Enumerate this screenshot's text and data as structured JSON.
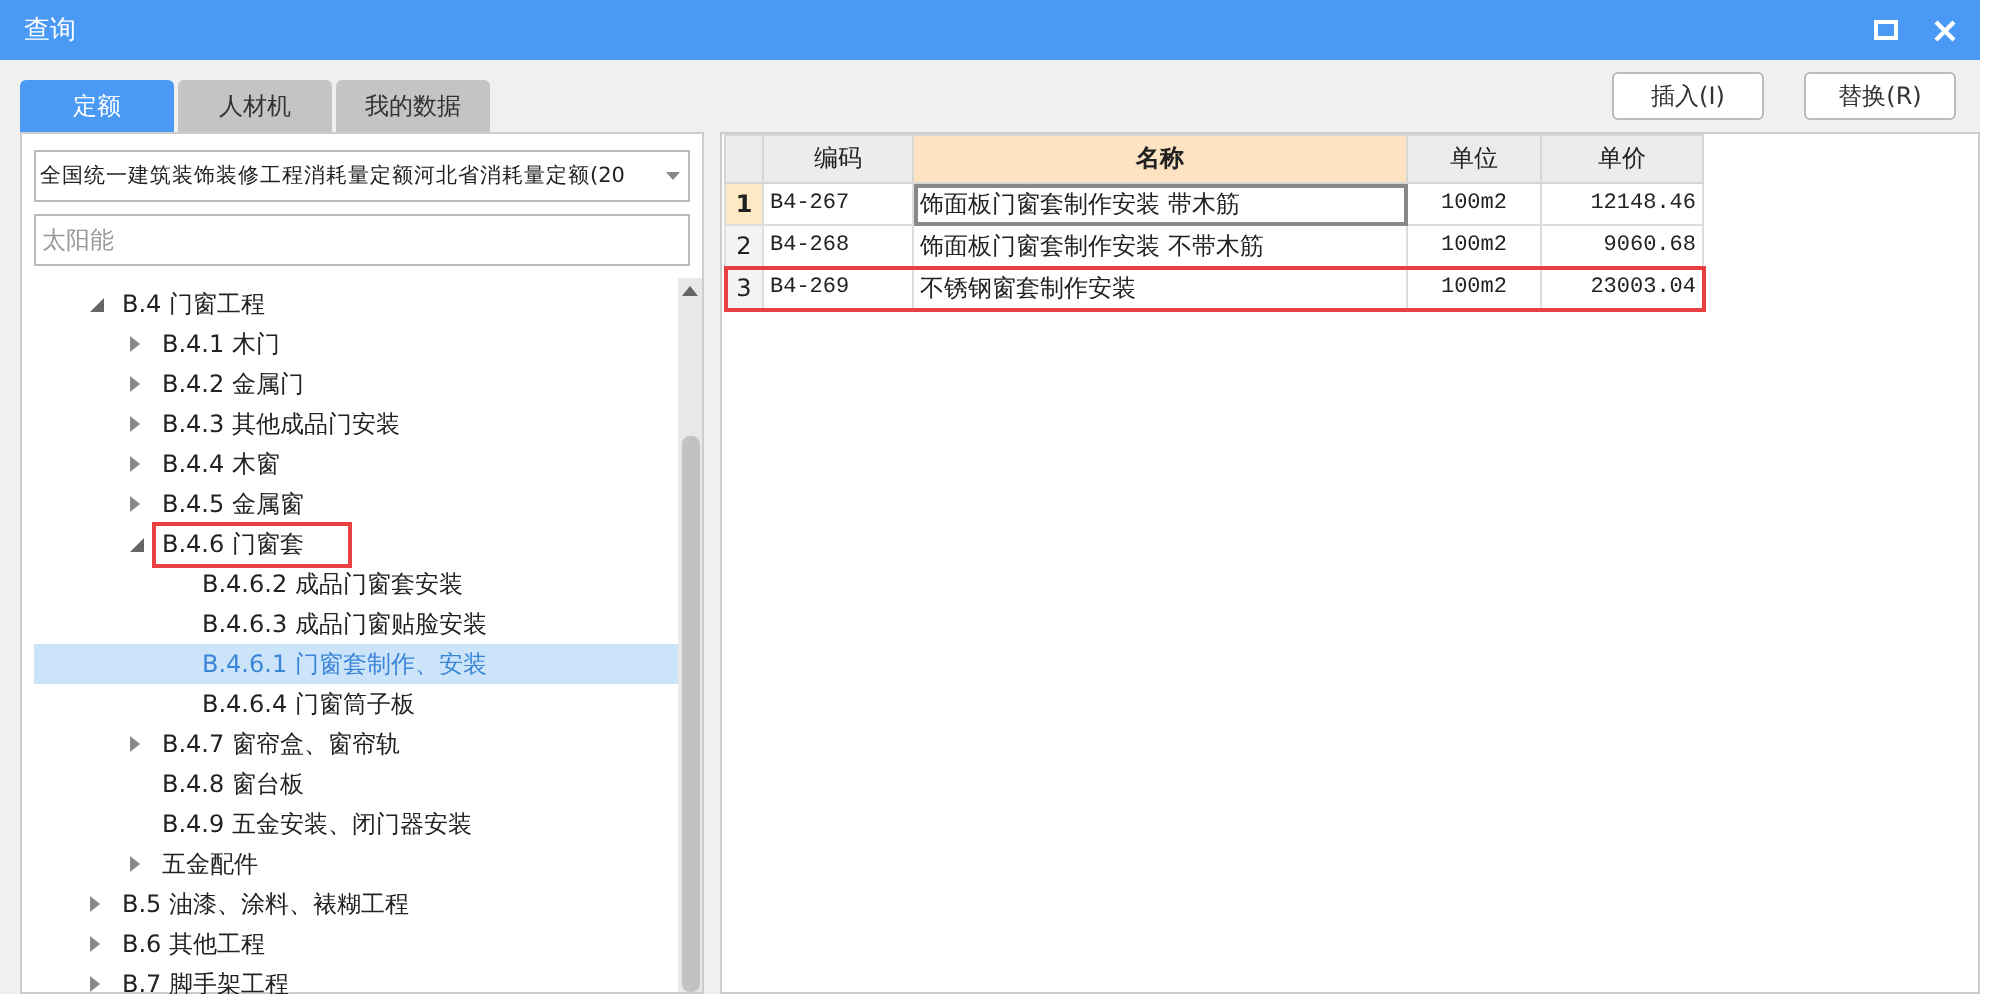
{
  "window": {
    "title": "查询"
  },
  "tabs": [
    {
      "label": "定额",
      "selected": true
    },
    {
      "label": "人材机",
      "selected": false
    },
    {
      "label": "我的数据",
      "selected": false
    }
  ],
  "library": {
    "value": "全国统一建筑装饰装修工程消耗量定额河北省消耗量定额(20"
  },
  "search": {
    "value": "太阳能"
  },
  "tree": [
    {
      "label": "B.4 门窗工程",
      "expanded": true,
      "selected": false,
      "highlighted": false,
      "children": [
        {
          "label": "B.4.1 木门",
          "expanded": false,
          "selected": false,
          "highlighted": false
        },
        {
          "label": "B.4.2 金属门",
          "expanded": false,
          "selected": false,
          "highlighted": false
        },
        {
          "label": "B.4.3 其他成品门安装",
          "expanded": false,
          "selected": false,
          "highlighted": false
        },
        {
          "label": "B.4.4 木窗",
          "expanded": false,
          "selected": false,
          "highlighted": false
        },
        {
          "label": "B.4.5 金属窗",
          "expanded": false,
          "selected": false,
          "highlighted": false
        },
        {
          "label": "B.4.6 门窗套",
          "expanded": true,
          "selected": false,
          "highlighted": true,
          "children": [
            {
              "label": "B.4.6.2 成品门窗套安装",
              "selected": false,
              "highlighted": false
            },
            {
              "label": "B.4.6.3 成品门窗贴脸安装",
              "selected": false,
              "highlighted": false
            },
            {
              "label": "B.4.6.1 门窗套制作、安装",
              "selected": true,
              "highlighted": false
            },
            {
              "label": "B.4.6.4 门窗筒子板",
              "selected": false,
              "highlighted": false
            }
          ]
        },
        {
          "label": "B.4.7 窗帘盒、窗帘轨",
          "expanded": false,
          "selected": false,
          "highlighted": false
        },
        {
          "label": "B.4.8 窗台板",
          "selected": false,
          "highlighted": false
        },
        {
          "label": "B.4.9 五金安装、闭门器安装",
          "selected": false,
          "highlighted": false
        },
        {
          "label": "五金配件",
          "expanded": false,
          "selected": false,
          "highlighted": false
        }
      ]
    },
    {
      "label": "B.5 油漆、涂料、裱糊工程",
      "expanded": false,
      "selected": false,
      "highlighted": false
    },
    {
      "label": "B.6 其他工程",
      "expanded": false,
      "selected": false,
      "highlighted": false
    },
    {
      "label": "B.7 脚手架工程",
      "expanded": false,
      "selected": false,
      "highlighted": false
    }
  ],
  "buttons": [
    "插入(I)",
    "替换(R)"
  ],
  "table": {
    "columns": [
      "编码",
      "名称",
      "单位",
      "单价"
    ],
    "rows": [
      {
        "index": "1",
        "code": "B4-267",
        "name": "饰面板门窗套制作安装 带木筋",
        "unit": "100m2",
        "price": "12148.46",
        "selected": true,
        "highlighted": false
      },
      {
        "index": "2",
        "code": "B4-268",
        "name": "饰面板门窗套制作安装 不带木筋",
        "unit": "100m2",
        "price": "9060.68",
        "selected": false,
        "highlighted": false
      },
      {
        "index": "3",
        "code": "B4-269",
        "name": "不锈钢窗套制作安装",
        "unit": "100m2",
        "price": "23003.04",
        "selected": false,
        "highlighted": true
      }
    ]
  }
}
